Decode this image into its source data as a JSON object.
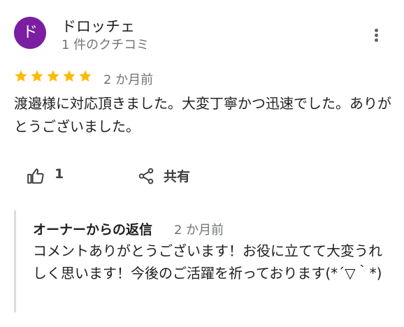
{
  "review": {
    "avatar_initial": "ド",
    "avatar_color": "#7b1fa2",
    "author_name": "ドロッチェ",
    "author_meta": "1 件のクチコミ",
    "rating": 5,
    "rating_max": 5,
    "star_color": "#fbbc04",
    "date": "2 か月前",
    "text": "渡邉様に対応頂きました。大変丁寧かつ迅速でした。ありがとうございました。",
    "more_icon": "more-vert-icon"
  },
  "actions": {
    "like_icon": "thumb-up-icon",
    "like_count": "1",
    "share_icon": "share-icon",
    "share_label": "共有"
  },
  "owner_reply": {
    "title": "オーナーからの返信",
    "date": "2 か月前",
    "text": "コメントありがとうございます！お役に立てて大変うれしく思います！今後のご活躍を祈っております(*´▽｀*)"
  }
}
